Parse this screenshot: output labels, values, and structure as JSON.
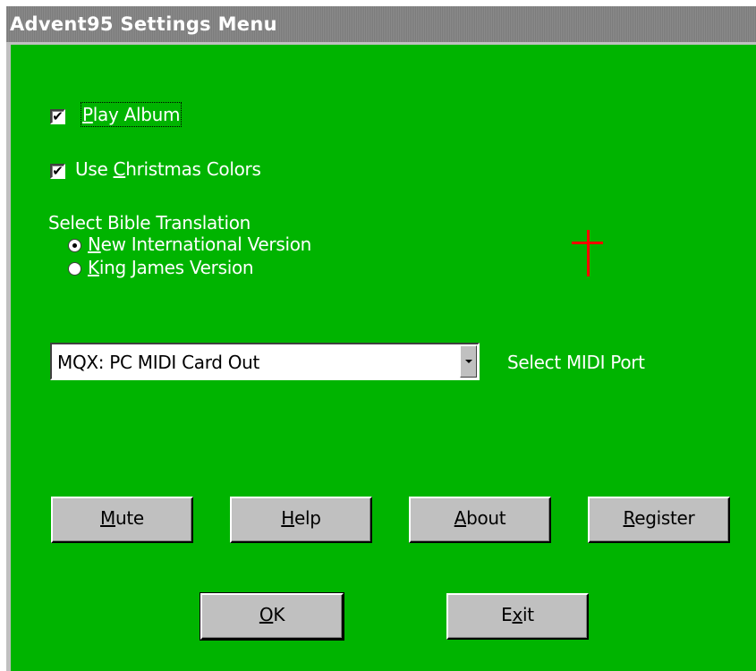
{
  "window": {
    "title": "Advent95 Settings Menu"
  },
  "options": {
    "play_album": {
      "checked": true,
      "label_pre": "",
      "label_accel": "P",
      "label_post": "lay Album"
    },
    "christmas_colors": {
      "checked": true,
      "label_pre": "Use ",
      "label_accel": "C",
      "label_post": "hristmas Colors"
    }
  },
  "translation": {
    "heading": "Select Bible Translation",
    "options": [
      {
        "selected": true,
        "label_accel": "N",
        "label_post": "ew International Version"
      },
      {
        "selected": false,
        "label_accel": "K",
        "label_post": "ing James Version"
      }
    ]
  },
  "midi": {
    "selected_port": "MQX: PC MIDI Card Out",
    "label": "Select MIDI Port"
  },
  "buttons": {
    "mute": {
      "accel": "M",
      "post": "ute",
      "pre": ""
    },
    "help": {
      "accel": "H",
      "post": "elp",
      "pre": ""
    },
    "about": {
      "accel": "A",
      "post": "bout",
      "pre": ""
    },
    "register": {
      "accel": "R",
      "post": "egister",
      "pre": ""
    },
    "ok": {
      "accel": "O",
      "post": "K",
      "pre": ""
    },
    "exit": {
      "pre": "E",
      "accel": "x",
      "post": "it"
    }
  },
  "colors": {
    "background": "#00b400",
    "label_text": "#ffffff",
    "cross": "#ff0000"
  },
  "icons": {
    "cross": "cross-icon"
  }
}
